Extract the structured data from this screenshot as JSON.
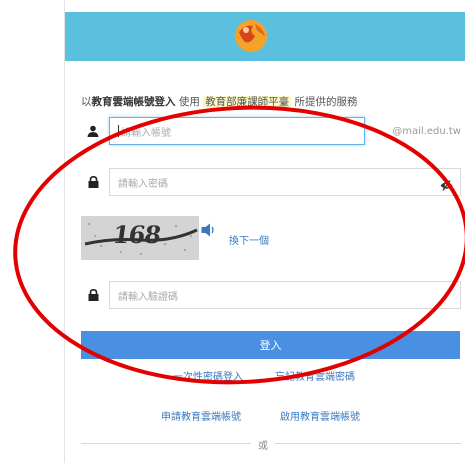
{
  "intro": {
    "prefix": "以",
    "bold": "教育雲端帳號登入",
    "mid": " 使用 ",
    "highlight": "教育部廉課師平臺",
    "suffix": " 所提供的服務"
  },
  "account": {
    "placeholder": "請輸入帳號",
    "domain_suffix": "@mail.edu.tw"
  },
  "password": {
    "placeholder": "請輸入密碼"
  },
  "captcha": {
    "image_text": "168",
    "next_label": "換下一個"
  },
  "verify": {
    "placeholder": "請輸入驗證碼"
  },
  "buttons": {
    "login": "登入"
  },
  "links": {
    "otp_login": "一次性密碼登入",
    "forgot_password": "忘記教育雲端密碼",
    "apply_account": "申請教育雲端帳號",
    "activate_account": "啟用教育雲端帳號"
  },
  "divider": {
    "or": "或"
  },
  "colors": {
    "header": "#5bc0de",
    "login_button": "#4a90e2",
    "link": "#3a79c0",
    "annotation": "#e30000"
  },
  "icons": [
    "globe-logo-icon",
    "user-icon",
    "lock-icon",
    "eye-slash-icon",
    "speaker-icon"
  ]
}
